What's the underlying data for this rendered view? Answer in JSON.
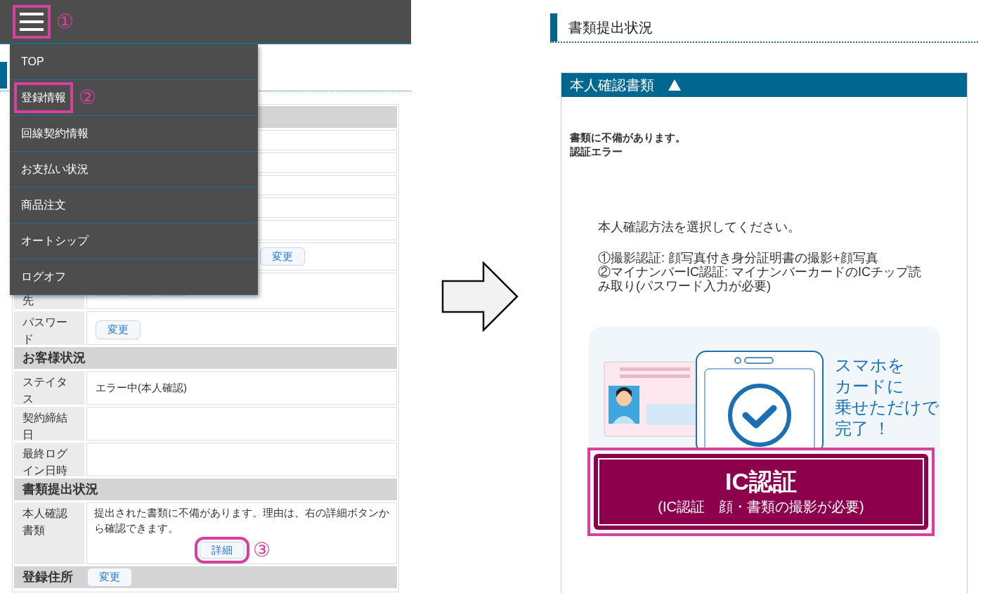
{
  "left_screen": {
    "menu_button": {
      "highlighted": true,
      "step": "①"
    },
    "menu": [
      {
        "label": "TOP",
        "highlighted": false
      },
      {
        "label": "登録情報",
        "highlighted": true,
        "step": "②"
      },
      {
        "label": "回線契約情報",
        "highlighted": false
      },
      {
        "label": "お支払い状況",
        "highlighted": false
      },
      {
        "label": "商品注文",
        "highlighted": false
      },
      {
        "label": "オートシップ",
        "highlighted": false
      },
      {
        "label": "ログオフ",
        "highlighted": false
      }
    ],
    "covered_change_button": "変更",
    "registration_rows": [
      {
        "kind": "blurred",
        "label": "先"
      },
      {
        "kind": "button",
        "label": "パスワード",
        "button": "変更"
      }
    ],
    "customer_status": {
      "title": "お客様状況",
      "rows": [
        {
          "kind": "text",
          "label": "ステイタス",
          "value": "エラー中(本人確認)"
        },
        {
          "kind": "empty",
          "label": "契約締結日"
        },
        {
          "kind": "empty",
          "label": "最終ログイン日時"
        }
      ]
    },
    "documents": {
      "title": "書類提出状況",
      "rows": [
        {
          "kind": "detail",
          "label": "本人確認書類",
          "value": "提出された書類に不備があります。理由は、右の詳細ボタンから確認できます。",
          "button": "詳細",
          "highlighted": true,
          "step": "③"
        }
      ]
    },
    "address": {
      "title": "登録住所",
      "button": "変更"
    }
  },
  "right_screen": {
    "section_title": "書類提出状況",
    "panel": {
      "title": "本人確認書類",
      "expanded": true,
      "errors": [
        "書類に不備があります。",
        "認証エラー"
      ],
      "instruction": "本人確認方法を選択してください。",
      "methods": [
        "①撮影認証: 顔写真付き身分証明書の撮影+顔写真",
        "②マイナンバーIC認証: マイナンバーカードのICチップ読み取り(パスワード入力が必要)"
      ],
      "banner_text": [
        "スマホを",
        "カードに",
        "乗せただけで",
        "完了 ！"
      ],
      "ic_button": {
        "title": "IC認証",
        "subtitle": "(IC認証　顔・書類の撮影が必要)",
        "highlighted": true
      }
    }
  }
}
